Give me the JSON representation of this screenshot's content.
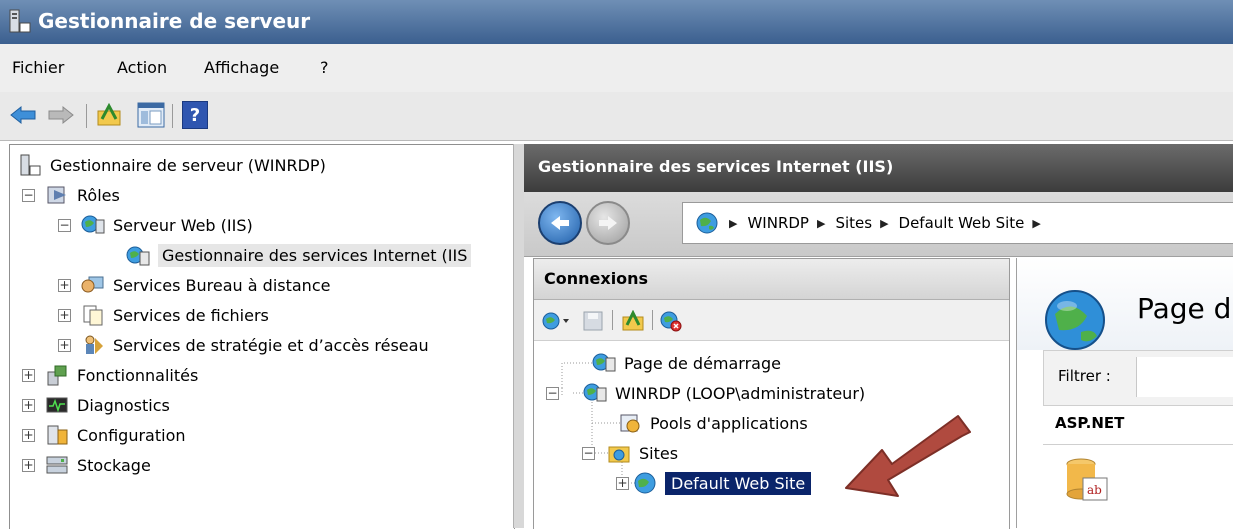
{
  "window": {
    "title": "Gestionnaire de serveur"
  },
  "menu": {
    "items": [
      "Fichier",
      "Action",
      "Affichage",
      "?"
    ]
  },
  "toolbar": {
    "help_label": "?"
  },
  "tree": {
    "items": [
      {
        "label": "Gestionnaire de serveur (WINRDP)",
        "icon": "server-manager-icon"
      },
      {
        "label": "Rôles",
        "icon": "roles-icon",
        "expander": "−"
      },
      {
        "label": "Serveur Web (IIS)",
        "icon": "web-server-icon",
        "expander": "−"
      },
      {
        "label": "Gestionnaire des services Internet (IIS",
        "icon": "iis-manager-icon"
      },
      {
        "label": "Services Bureau à distance",
        "icon": "remote-desktop-icon",
        "expander": "+"
      },
      {
        "label": "Services de fichiers",
        "icon": "file-services-icon",
        "expander": "+"
      },
      {
        "label": "Services de stratégie et d’accès réseau",
        "icon": "network-policy-icon",
        "expander": "+"
      },
      {
        "label": "Fonctionnalités",
        "icon": "features-icon",
        "expander": "+"
      },
      {
        "label": "Diagnostics",
        "icon": "diagnostics-icon",
        "expander": "+"
      },
      {
        "label": "Configuration",
        "icon": "configuration-icon",
        "expander": "+"
      },
      {
        "label": "Stockage",
        "icon": "storage-icon",
        "expander": "+"
      }
    ]
  },
  "iis": {
    "header": "Gestionnaire des services Internet (IIS)",
    "breadcrumb": [
      "WINRDP",
      "Sites",
      "Default Web Site"
    ],
    "breadcrumb_separator": "▶"
  },
  "connections": {
    "title": "Connexions",
    "items": [
      {
        "label": "Page de démarrage",
        "icon": "start-page-icon"
      },
      {
        "label": "WINRDP (LOOP\\administrateur)",
        "icon": "server-node-icon",
        "expander": "−"
      },
      {
        "label": "Pools d'applications",
        "icon": "app-pools-icon"
      },
      {
        "label": "Sites",
        "icon": "sites-folder-icon",
        "expander": "−"
      },
      {
        "label": "Default Web Site",
        "icon": "globe-icon",
        "expander": "+",
        "selected": true
      }
    ]
  },
  "home": {
    "title": "Page d",
    "filter_label": "Filtrer :",
    "group_label": "ASP.NET"
  },
  "colors": {
    "selection": "#0a246a",
    "arrow_annotation": "#b04a3f",
    "title_bar": "#3b5f8f"
  }
}
